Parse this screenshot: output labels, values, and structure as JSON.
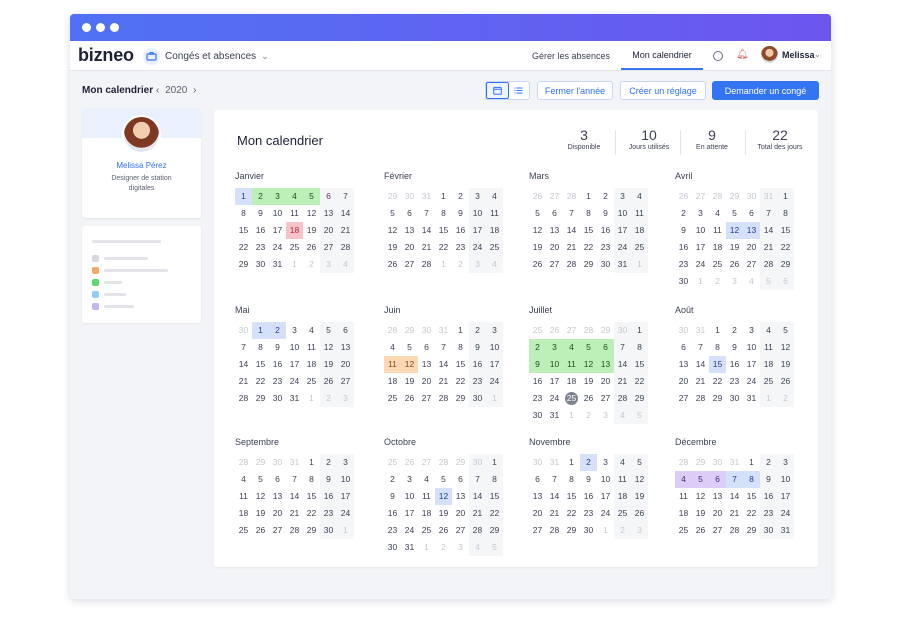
{
  "app": {
    "logo": "bizneo",
    "module": "Congés et absences"
  },
  "nav": {
    "links": [
      "Gérer les absences",
      "Mon calendrier"
    ],
    "active": "Mon calendrier",
    "user": "Melissa"
  },
  "toolbar": {
    "breadcrumb": "Mon calendrier",
    "year": "2020",
    "close_year": "Fermer l'année",
    "create_setting": "Créer un réglage",
    "request_leave": "Demander un congé"
  },
  "profile": {
    "name": "Melissa Pérez",
    "role": "Designer de station digitales"
  },
  "main": {
    "title": "Mon calendrier",
    "stats": [
      {
        "value": "3",
        "label": "Disponible"
      },
      {
        "value": "10",
        "label": "Jours utilisés"
      },
      {
        "value": "9",
        "label": "En attente"
      },
      {
        "value": "22",
        "label": "Total des jours"
      }
    ]
  },
  "colors": {
    "accent": "#3374f2",
    "approved": "#bdf0b8",
    "pending": "#d5e1fb",
    "rejected": "#f6c3c9",
    "holiday": "#fcd8b5",
    "other": "#dccdf7"
  },
  "calendar": {
    "months": [
      {
        "name": "Janvier",
        "weeks": [
          [
            "1",
            "2",
            "3",
            "4",
            "5",
            "6",
            "7"
          ],
          [
            "8",
            "9",
            "10",
            "11",
            "12",
            "13",
            "14"
          ],
          [
            "15",
            "16",
            "17",
            "18",
            "19",
            "20",
            "21"
          ],
          [
            "22",
            "23",
            "24",
            "25",
            "26",
            "27",
            "28"
          ],
          [
            "29",
            "30",
            "31",
            "1",
            "2",
            "3",
            "4"
          ]
        ],
        "first_out": 0,
        "marks": {
          "1": "blue",
          "2": "green",
          "3": "green",
          "4": "green",
          "5": "green",
          "18": "red"
        }
      },
      {
        "name": "Février",
        "weeks": [
          [
            "29",
            "30",
            "31",
            "1",
            "2",
            "3",
            "4"
          ],
          [
            "5",
            "6",
            "7",
            "8",
            "9",
            "10",
            "11"
          ],
          [
            "12",
            "13",
            "14",
            "15",
            "16",
            "17",
            "18"
          ],
          [
            "19",
            "20",
            "21",
            "22",
            "23",
            "24",
            "25"
          ],
          [
            "26",
            "27",
            "28",
            "1",
            "2",
            "3",
            "4"
          ]
        ],
        "first_out": 3,
        "marks": {}
      },
      {
        "name": "Mars",
        "weeks": [
          [
            "26",
            "27",
            "28",
            "1",
            "2",
            "3",
            "4"
          ],
          [
            "5",
            "6",
            "7",
            "8",
            "9",
            "10",
            "11"
          ],
          [
            "12",
            "13",
            "14",
            "15",
            "16",
            "17",
            "18"
          ],
          [
            "19",
            "20",
            "21",
            "22",
            "23",
            "24",
            "25"
          ],
          [
            "26",
            "27",
            "28",
            "29",
            "30",
            "31",
            "1"
          ]
        ],
        "first_out": 3,
        "marks": {}
      },
      {
        "name": "Avril",
        "weeks": [
          [
            "26",
            "27",
            "28",
            "29",
            "30",
            "31",
            "1"
          ],
          [
            "2",
            "3",
            "4",
            "5",
            "6",
            "7",
            "8"
          ],
          [
            "9",
            "10",
            "11",
            "12",
            "13",
            "14",
            "15"
          ],
          [
            "16",
            "17",
            "18",
            "19",
            "20",
            "21",
            "22"
          ],
          [
            "23",
            "24",
            "25",
            "26",
            "27",
            "28",
            "29"
          ],
          [
            "30",
            "1",
            "2",
            "3",
            "4",
            "5",
            "6"
          ]
        ],
        "first_out": 6,
        "marks": {
          "12": "blue",
          "13": "blue"
        }
      },
      {
        "name": "Mai",
        "weeks": [
          [
            "30",
            "1",
            "2",
            "3",
            "4",
            "5",
            "6"
          ],
          [
            "7",
            "8",
            "9",
            "10",
            "11",
            "12",
            "13"
          ],
          [
            "14",
            "15",
            "16",
            "17",
            "18",
            "19",
            "20"
          ],
          [
            "21",
            "22",
            "23",
            "24",
            "25",
            "26",
            "27"
          ],
          [
            "28",
            "29",
            "30",
            "31",
            "1",
            "2",
            "3"
          ]
        ],
        "first_out": 1,
        "marks": {
          "1": "blue",
          "2": "blue"
        }
      },
      {
        "name": "Juin",
        "weeks": [
          [
            "28",
            "29",
            "30",
            "31",
            "1",
            "2",
            "3"
          ],
          [
            "4",
            "5",
            "6",
            "7",
            "8",
            "9",
            "10"
          ],
          [
            "11",
            "12",
            "13",
            "14",
            "15",
            "16",
            "17"
          ],
          [
            "18",
            "19",
            "20",
            "21",
            "22",
            "23",
            "24"
          ],
          [
            "25",
            "26",
            "27",
            "28",
            "29",
            "30",
            "1"
          ]
        ],
        "first_out": 4,
        "marks": {
          "11": "orange",
          "12": "orange"
        }
      },
      {
        "name": "Juillet",
        "weeks": [
          [
            "25",
            "26",
            "27",
            "28",
            "29",
            "30",
            "1"
          ],
          [
            "2",
            "3",
            "4",
            "5",
            "6",
            "7",
            "8"
          ],
          [
            "9",
            "10",
            "11",
            "12",
            "13",
            "14",
            "15"
          ],
          [
            "16",
            "17",
            "18",
            "19",
            "20",
            "21",
            "22"
          ],
          [
            "23",
            "24",
            "25",
            "26",
            "27",
            "28",
            "29"
          ],
          [
            "30",
            "31",
            "1",
            "2",
            "3",
            "4",
            "5"
          ]
        ],
        "first_out": 6,
        "marks": {
          "2": "green",
          "3": "green",
          "4": "green",
          "5": "green",
          "6": "green",
          "9": "green",
          "10": "green",
          "11": "green",
          "12": "green",
          "13": "green",
          "25": "today"
        }
      },
      {
        "name": "Août",
        "weeks": [
          [
            "30",
            "31",
            "1",
            "2",
            "3",
            "4",
            "5"
          ],
          [
            "6",
            "7",
            "8",
            "9",
            "10",
            "11",
            "12"
          ],
          [
            "13",
            "14",
            "15",
            "16",
            "17",
            "18",
            "19"
          ],
          [
            "20",
            "21",
            "22",
            "23",
            "24",
            "25",
            "26"
          ],
          [
            "27",
            "28",
            "29",
            "30",
            "31",
            "1",
            "2"
          ]
        ],
        "first_out": 2,
        "marks": {
          "15": "blue"
        }
      },
      {
        "name": "Septembre",
        "weeks": [
          [
            "28",
            "29",
            "30",
            "31",
            "1",
            "2",
            "3"
          ],
          [
            "4",
            "5",
            "6",
            "7",
            "8",
            "9",
            "10"
          ],
          [
            "11",
            "12",
            "13",
            "14",
            "15",
            "16",
            "17"
          ],
          [
            "18",
            "19",
            "20",
            "21",
            "22",
            "23",
            "24"
          ],
          [
            "25",
            "26",
            "27",
            "28",
            "29",
            "30",
            "1"
          ]
        ],
        "first_out": 4,
        "marks": {}
      },
      {
        "name": "Octobre",
        "weeks": [
          [
            "25",
            "26",
            "27",
            "28",
            "29",
            "30",
            "1"
          ],
          [
            "2",
            "3",
            "4",
            "5",
            "6",
            "7",
            "8"
          ],
          [
            "9",
            "10",
            "11",
            "12",
            "13",
            "14",
            "15"
          ],
          [
            "16",
            "17",
            "18",
            "19",
            "20",
            "21",
            "22"
          ],
          [
            "23",
            "24",
            "25",
            "26",
            "27",
            "28",
            "29"
          ],
          [
            "30",
            "31",
            "1",
            "2",
            "3",
            "4",
            "5"
          ]
        ],
        "first_out": 6,
        "marks": {
          "12": "blue"
        }
      },
      {
        "name": "Novembre",
        "weeks": [
          [
            "30",
            "31",
            "1",
            "2",
            "3",
            "4",
            "5"
          ],
          [
            "6",
            "7",
            "8",
            "9",
            "10",
            "11",
            "12"
          ],
          [
            "13",
            "14",
            "15",
            "16",
            "17",
            "18",
            "19"
          ],
          [
            "20",
            "21",
            "22",
            "23",
            "24",
            "25",
            "26"
          ],
          [
            "27",
            "28",
            "29",
            "30",
            "1",
            "2",
            "3"
          ]
        ],
        "first_out": 2,
        "marks": {
          "2": "blue"
        }
      },
      {
        "name": "Décembre",
        "weeks": [
          [
            "28",
            "29",
            "30",
            "31",
            "1",
            "2",
            "3"
          ],
          [
            "4",
            "5",
            "6",
            "7",
            "8",
            "9",
            "10"
          ],
          [
            "11",
            "12",
            "13",
            "14",
            "15",
            "16",
            "17"
          ],
          [
            "18",
            "19",
            "20",
            "21",
            "22",
            "23",
            "24"
          ],
          [
            "25",
            "26",
            "27",
            "28",
            "29",
            "30",
            "31"
          ]
        ],
        "first_out": 4,
        "marks": {
          "4": "purple",
          "5": "purple",
          "6": "purple",
          "7": "blue",
          "8": "blue"
        }
      }
    ]
  }
}
